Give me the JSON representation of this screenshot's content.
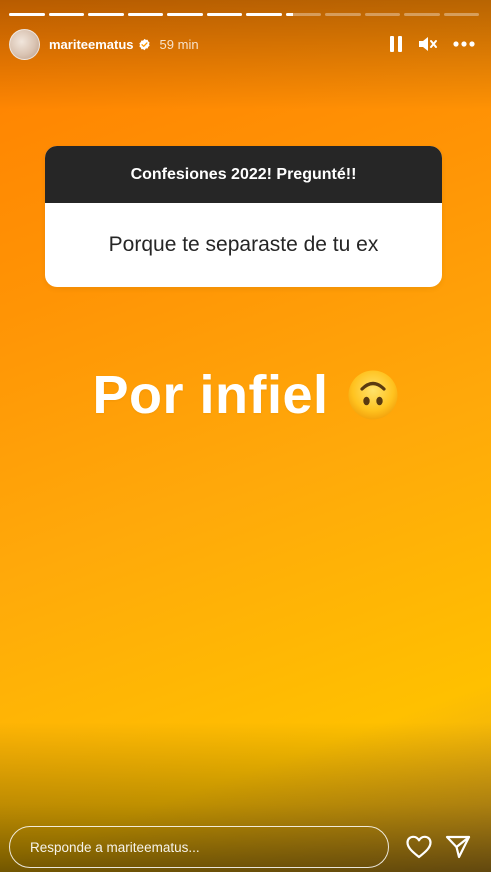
{
  "story": {
    "progress_segments": [
      1,
      1,
      1,
      1,
      1,
      1,
      1,
      0.2,
      0,
      0,
      0,
      0
    ],
    "background_colors": [
      "#ff7f00",
      "#ffa90a",
      "#ffc000"
    ]
  },
  "header": {
    "username": "mariteematus",
    "verified": true,
    "time": "59 min",
    "icons": [
      "pause-icon",
      "muted-speaker-icon",
      "more-options-icon"
    ]
  },
  "question_box": {
    "title": "Confesiones 2022! Pregunté!!",
    "question": "Porque te separaste de tu ex"
  },
  "answer": {
    "text": "Por infiel",
    "emoji": "upside-down-face-emoji"
  },
  "footer": {
    "reply_placeholder": "Responde a mariteematus...",
    "icons": [
      "heart-icon",
      "send-icon"
    ]
  }
}
